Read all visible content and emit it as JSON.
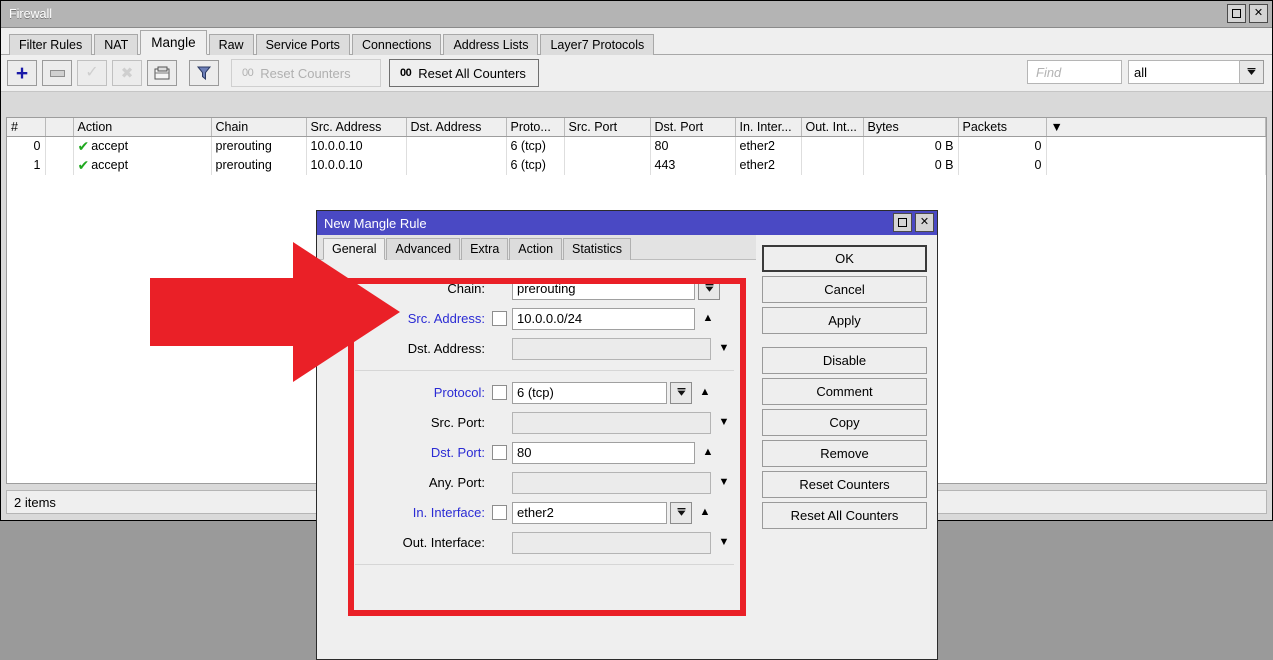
{
  "firewall": {
    "title": "Firewall",
    "window_buttons": {
      "restore": "restore-icon",
      "close": "✕"
    },
    "tabs": [
      {
        "label": "Filter Rules",
        "active": false
      },
      {
        "label": "NAT",
        "active": false
      },
      {
        "label": "Mangle",
        "active": true
      },
      {
        "label": "Raw",
        "active": false
      },
      {
        "label": "Service Ports",
        "active": false
      },
      {
        "label": "Connections",
        "active": false
      },
      {
        "label": "Address Lists",
        "active": false
      },
      {
        "label": "Layer7 Protocols",
        "active": false
      }
    ],
    "toolbar": {
      "add_label": "+",
      "remove_label": "–",
      "enable_label": "✓",
      "disable_label": "✕",
      "comment_label": "comment-icon",
      "filter_label": "filter-icon",
      "reset_counters": {
        "prefix": "00",
        "label": "Reset Counters",
        "enabled": false
      },
      "reset_all_counters": {
        "prefix": "00",
        "label": "Reset All Counters",
        "enabled": true
      },
      "find_placeholder": "Find",
      "find_value": "",
      "filter_selected": "all"
    },
    "table": {
      "columns": [
        "#",
        "",
        "Action",
        "Chain",
        "Src. Address",
        "Dst. Address",
        "Proto...",
        "Src. Port",
        "Dst. Port",
        "In. Inter...",
        "Out. Int...",
        "Bytes",
        "Packets",
        ""
      ],
      "rows": [
        {
          "index": "0",
          "flag": "",
          "action": "accept",
          "action_icon": "check-icon",
          "chain": "prerouting",
          "src_address": "10.0.0.10",
          "dst_address": "",
          "protocol": "6 (tcp)",
          "src_port": "",
          "dst_port": "80",
          "in_interface": "ether2",
          "out_interface": "",
          "bytes": "0 B",
          "packets": "0",
          "extra": ""
        },
        {
          "index": "1",
          "flag": "",
          "action": "accept",
          "action_icon": "check-icon",
          "chain": "prerouting",
          "src_address": "10.0.0.10",
          "dst_address": "",
          "protocol": "6 (tcp)",
          "src_port": "",
          "dst_port": "443",
          "in_interface": "ether2",
          "out_interface": "",
          "bytes": "0 B",
          "packets": "0",
          "extra": ""
        }
      ]
    },
    "status": "2 items"
  },
  "dialog": {
    "title": "New Mangle Rule",
    "window_buttons": {
      "restore": "restore-icon",
      "close": "✕"
    },
    "tabs": [
      {
        "label": "General",
        "active": true
      },
      {
        "label": "Advanced",
        "active": false
      },
      {
        "label": "Extra",
        "active": false
      },
      {
        "label": "Action",
        "active": false
      },
      {
        "label": "Statistics",
        "active": false
      }
    ],
    "fields": [
      {
        "label": "Chain:",
        "highlighted": false,
        "checkbox": false,
        "value": "prerouting",
        "has_dropdown": true,
        "arrow": "",
        "empty": false
      },
      {
        "label": "Src. Address:",
        "highlighted": true,
        "checkbox": true,
        "value": "10.0.0.0/24",
        "has_dropdown": false,
        "arrow": "▲",
        "empty": false
      },
      {
        "label": "Dst. Address:",
        "highlighted": false,
        "checkbox": false,
        "value": "",
        "has_dropdown": false,
        "arrow": "▼",
        "empty": true
      },
      {
        "label": "Protocol:",
        "highlighted": true,
        "checkbox": true,
        "value": "6 (tcp)",
        "has_dropdown": true,
        "arrow": "▲",
        "empty": false
      },
      {
        "label": "Src. Port:",
        "highlighted": false,
        "checkbox": false,
        "value": "",
        "has_dropdown": false,
        "arrow": "▼",
        "empty": true
      },
      {
        "label": "Dst. Port:",
        "highlighted": true,
        "checkbox": true,
        "value": "80",
        "has_dropdown": false,
        "arrow": "▲",
        "empty": false
      },
      {
        "label": "Any. Port:",
        "highlighted": false,
        "checkbox": false,
        "value": "",
        "has_dropdown": false,
        "arrow": "▼",
        "empty": true
      },
      {
        "label": "In. Interface:",
        "highlighted": true,
        "checkbox": true,
        "value": "ether2",
        "has_dropdown": true,
        "arrow": "▲",
        "empty": false
      },
      {
        "label": "Out. Interface:",
        "highlighted": false,
        "checkbox": false,
        "value": "",
        "has_dropdown": false,
        "arrow": "▼",
        "empty": true
      }
    ],
    "buttons": [
      {
        "label": "OK",
        "primary": true,
        "gap_before": false
      },
      {
        "label": "Cancel",
        "primary": false,
        "gap_before": false
      },
      {
        "label": "Apply",
        "primary": false,
        "gap_before": false
      },
      {
        "label": "Disable",
        "primary": false,
        "gap_before": true
      },
      {
        "label": "Comment",
        "primary": false,
        "gap_before": false
      },
      {
        "label": "Copy",
        "primary": false,
        "gap_before": false
      },
      {
        "label": "Remove",
        "primary": false,
        "gap_before": false
      },
      {
        "label": "Reset Counters",
        "primary": false,
        "gap_before": false
      },
      {
        "label": "Reset All Counters",
        "primary": false,
        "gap_before": false
      }
    ]
  },
  "annotation": {
    "arrow_color": "#ea2027",
    "box_color": "#ea2027",
    "arrow_name": "red-pointer-arrow",
    "box_name": "red-highlight-box"
  }
}
